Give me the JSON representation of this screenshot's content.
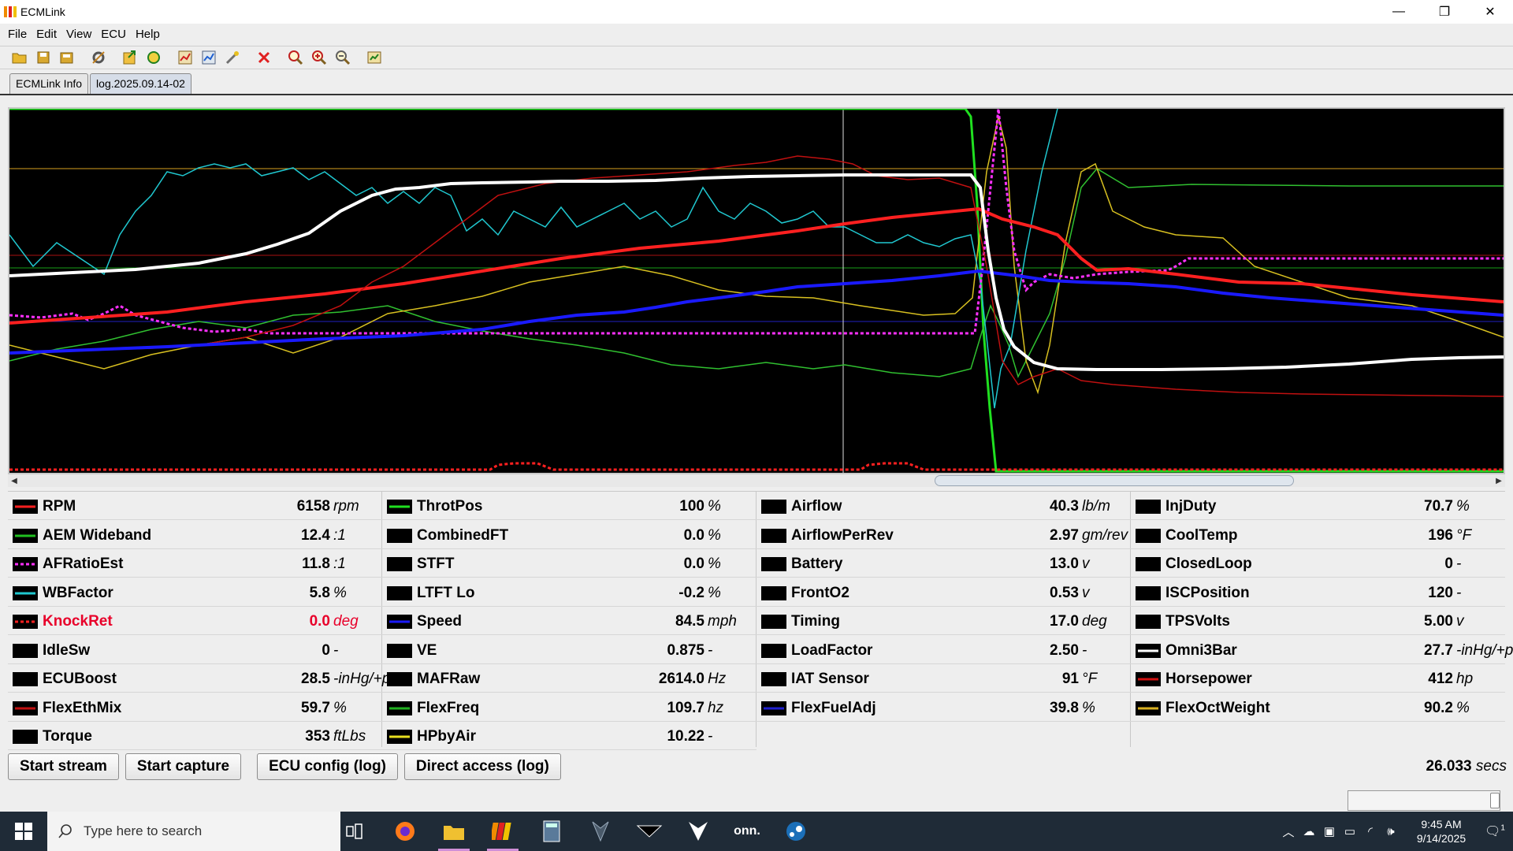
{
  "window": {
    "title": "ECMLink",
    "minimize": "—",
    "restore": "❐",
    "close": "✕"
  },
  "menu": [
    {
      "label": "File"
    },
    {
      "label": "Edit"
    },
    {
      "label": "View"
    },
    {
      "label": "ECU"
    },
    {
      "label": "Help"
    }
  ],
  "toolbar_icons": [
    "open-icon",
    "save-icon",
    "save-as-icon",
    "tools-icon",
    "export-icon",
    "refresh-icon",
    "map-icon",
    "map-compare-icon",
    "wrench-icon",
    "delete-icon",
    "zoom-full-icon",
    "zoom-in-icon",
    "zoom-out-icon",
    "settings-icon"
  ],
  "tabs": [
    {
      "label": "ECMLink Info",
      "active": false
    },
    {
      "label": "log.2025.09.14-02",
      "active": true
    }
  ],
  "params": [
    [
      {
        "name": "RPM",
        "value": "6158",
        "unit": "rpm",
        "color": "#ff2020",
        "dash": false
      },
      {
        "name": "AEM Wideband",
        "value": "12.4",
        "unit": ":1",
        "color": "#20c020",
        "dash": false
      },
      {
        "name": "AFRatioEst",
        "value": "11.8",
        "unit": ":1",
        "color": "#ff30ff",
        "dash": true
      },
      {
        "name": "WBFactor",
        "value": "5.8",
        "unit": "%",
        "color": "#20c8d0",
        "dash": false
      },
      {
        "name": "KnockRet",
        "value": "0.0",
        "unit": "deg",
        "color": "#ff2020",
        "dash": true,
        "red": true
      },
      {
        "name": "IdleSw",
        "value": "0",
        "unit": "-",
        "color": "#000000",
        "dash": false
      },
      {
        "name": "ECUBoost",
        "value": "28.5",
        "unit": "-inHg/+psi",
        "color": "#000000",
        "dash": false
      },
      {
        "name": "FlexEthMix",
        "value": "59.7",
        "unit": "%",
        "color": "#c01010",
        "dash": false
      },
      {
        "name": "Torque",
        "value": "353",
        "unit": "ftLbs",
        "color": "#000000",
        "dash": false
      }
    ],
    [
      {
        "name": "ThrotPos",
        "value": "100",
        "unit": "%",
        "color": "#20e020",
        "dash": false
      },
      {
        "name": "CombinedFT",
        "value": "0.0",
        "unit": "%",
        "color": "#000000",
        "dash": false
      },
      {
        "name": "STFT",
        "value": "0.0",
        "unit": "%",
        "color": "#000000",
        "dash": false
      },
      {
        "name": "LTFT Lo",
        "value": "-0.2",
        "unit": "%",
        "color": "#000000",
        "dash": false
      },
      {
        "name": "Speed",
        "value": "84.5",
        "unit": "mph",
        "color": "#1a1aff",
        "dash": false
      },
      {
        "name": "VE",
        "value": "0.875",
        "unit": "-",
        "color": "#000000",
        "dash": false
      },
      {
        "name": "MAFRaw",
        "value": "2614.0",
        "unit": "Hz",
        "color": "#000000",
        "dash": false
      },
      {
        "name": "FlexFreq",
        "value": "109.7",
        "unit": "hz",
        "color": "#20b020",
        "dash": false
      },
      {
        "name": "HPbyAir",
        "value": "10.22",
        "unit": "-",
        "color": "#e8e020",
        "dash": false
      }
    ],
    [
      {
        "name": "Airflow",
        "value": "40.3",
        "unit": "lb/m",
        "color": "#000000",
        "dash": false
      },
      {
        "name": "AirflowPerRev",
        "value": "2.97",
        "unit": "gm/rev",
        "color": "#000000",
        "dash": false
      },
      {
        "name": "Battery",
        "value": "13.0",
        "unit": "v",
        "color": "#000000",
        "dash": false
      },
      {
        "name": "FrontO2",
        "value": "0.53",
        "unit": "v",
        "color": "#000000",
        "dash": false
      },
      {
        "name": "Timing",
        "value": "17.0",
        "unit": "deg",
        "color": "#000000",
        "dash": false
      },
      {
        "name": "LoadFactor",
        "value": "2.50",
        "unit": "-",
        "color": "#000000",
        "dash": false
      },
      {
        "name": "IAT Sensor",
        "value": "91",
        "unit": "°F",
        "color": "#000000",
        "dash": false
      },
      {
        "name": "FlexFuelAdj",
        "value": "39.8",
        "unit": "%",
        "color": "#2020d0",
        "dash": false
      }
    ],
    [
      {
        "name": "InjDuty",
        "value": "70.7",
        "unit": "%",
        "color": "#000000",
        "dash": false
      },
      {
        "name": "CoolTemp",
        "value": "196",
        "unit": "°F",
        "color": "#000000",
        "dash": false
      },
      {
        "name": "ClosedLoop",
        "value": "0",
        "unit": "-",
        "color": "#000000",
        "dash": false
      },
      {
        "name": "ISCPosition",
        "value": "120",
        "unit": "-",
        "color": "#000000",
        "dash": false
      },
      {
        "name": "TPSVolts",
        "value": "5.00",
        "unit": "v",
        "color": "#000000",
        "dash": false
      },
      {
        "name": "Omni3Bar",
        "value": "27.7",
        "unit": "-inHg/+psi",
        "color": "#ffffff",
        "dash": false
      },
      {
        "name": "Horsepower",
        "value": "412",
        "unit": "hp",
        "color": "#d01010",
        "dash": false
      },
      {
        "name": "FlexOctWeight",
        "value": "90.2",
        "unit": "%",
        "color": "#d8b020",
        "dash": false
      }
    ]
  ],
  "buttons": [
    {
      "label": "Start stream"
    },
    {
      "label": "Start capture"
    },
    {
      "label": "ECU config (log)"
    },
    {
      "label": "Direct access (log)"
    }
  ],
  "elapsed": {
    "value": "26.033",
    "unit": "secs"
  },
  "taskbar": {
    "search_placeholder": "Type here to search",
    "apps": [
      "task-view",
      "firefox",
      "file-explorer",
      "ecmlink",
      "calculator",
      "predator-sense",
      "predator-1",
      "predator-2",
      "onn",
      "steam"
    ],
    "onn_label": "onn.",
    "time": "9:45 AM",
    "date": "9/14/2025",
    "notifications": "1"
  }
}
